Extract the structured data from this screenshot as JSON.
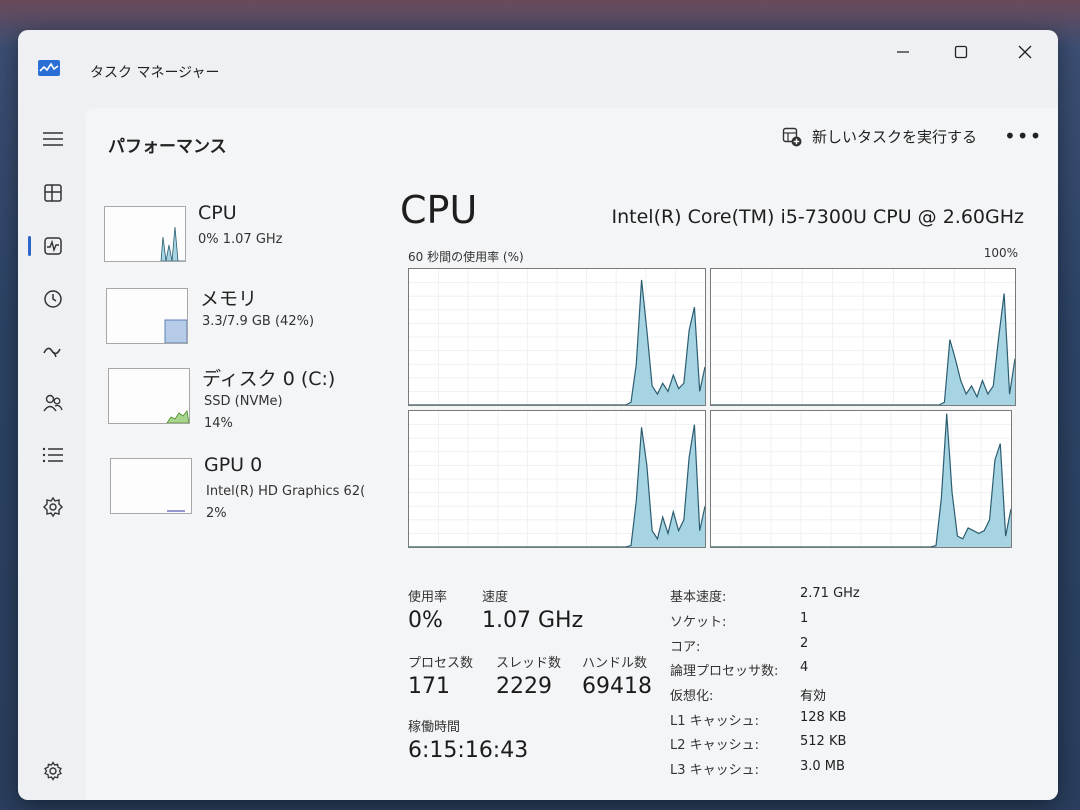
{
  "window": {
    "title": "タスク マネージャー"
  },
  "page": {
    "title": "パフォーマンス",
    "run_task_label": "新しいタスクを実行する",
    "more_label": "•••"
  },
  "nav": [
    "menu-icon",
    "processes-icon",
    "performance-icon",
    "app-history-icon",
    "startup-apps-icon",
    "users-icon",
    "details-icon",
    "services-icon",
    "settings-icon"
  ],
  "sidebar": {
    "items": [
      {
        "title": "CPU",
        "sub": "0%  1.07 GHz",
        "sub2": ""
      },
      {
        "title": "メモリ",
        "sub": "3.3/7.9 GB (42%)",
        "sub2": ""
      },
      {
        "title": "ディスク 0 (C:)",
        "sub": "SSD (NVMe)",
        "sub2": "14%"
      },
      {
        "title": "GPU 0",
        "sub": "Intel(R) HD Graphics 62(",
        "sub2": "2%"
      }
    ]
  },
  "main": {
    "title": "CPU",
    "processor": "Intel(R) Core(TM) i5-7300U CPU @ 2.60GHz",
    "graph_label": "60 秒間の使用率 (%)",
    "graph_max": "100%",
    "graph_color": "#a6d4e2",
    "graph_line": "#2c5d70",
    "cores": [
      [
        0,
        0,
        0,
        0,
        0,
        0,
        0,
        0,
        0,
        0,
        0,
        0,
        0,
        0,
        0,
        0,
        0,
        0,
        0,
        0,
        0,
        0,
        0,
        0,
        0,
        0,
        0,
        0,
        0,
        0,
        0,
        0,
        0,
        0,
        0,
        0,
        0,
        0,
        0,
        0,
        0,
        0,
        2,
        30,
        92,
        55,
        14,
        8,
        16,
        10,
        22,
        12,
        16,
        55,
        72,
        10,
        28
      ],
      [
        0,
        0,
        0,
        0,
        0,
        0,
        0,
        0,
        0,
        0,
        0,
        0,
        0,
        0,
        0,
        0,
        0,
        0,
        0,
        0,
        0,
        0,
        0,
        0,
        0,
        0,
        0,
        0,
        0,
        0,
        0,
        0,
        0,
        0,
        0,
        0,
        0,
        0,
        0,
        0,
        0,
        0,
        0,
        2,
        48,
        34,
        18,
        8,
        14,
        6,
        18,
        8,
        14,
        50,
        82,
        8,
        34
      ],
      [
        0,
        0,
        0,
        0,
        0,
        0,
        0,
        0,
        0,
        0,
        0,
        0,
        0,
        0,
        0,
        0,
        0,
        0,
        0,
        0,
        0,
        0,
        0,
        0,
        0,
        0,
        0,
        0,
        0,
        0,
        0,
        0,
        0,
        0,
        0,
        0,
        0,
        0,
        0,
        0,
        0,
        0,
        1,
        34,
        88,
        60,
        12,
        6,
        22,
        10,
        26,
        12,
        20,
        66,
        90,
        12,
        30
      ],
      [
        0,
        0,
        0,
        0,
        0,
        0,
        0,
        0,
        0,
        0,
        0,
        0,
        0,
        0,
        0,
        0,
        0,
        0,
        0,
        0,
        0,
        0,
        0,
        0,
        0,
        0,
        0,
        0,
        0,
        0,
        0,
        0,
        0,
        0,
        0,
        0,
        0,
        0,
        0,
        0,
        0,
        0,
        1,
        36,
        98,
        40,
        8,
        6,
        14,
        12,
        10,
        12,
        20,
        64,
        76,
        8,
        28
      ]
    ],
    "stats": {
      "usage_label": "使用率",
      "usage_value": "0%",
      "speed_label": "速度",
      "speed_value": "1.07 GHz",
      "processes_label": "プロセス数",
      "processes_value": "171",
      "threads_label": "スレッド数",
      "threads_value": "2229",
      "handles_label": "ハンドル数",
      "handles_value": "69418",
      "uptime_label": "稼働時間",
      "uptime_value": "6:15:16:43"
    },
    "specs": [
      {
        "label": "基本速度:",
        "value": "2.71 GHz"
      },
      {
        "label": "ソケット:",
        "value": "1"
      },
      {
        "label": "コア:",
        "value": "2"
      },
      {
        "label": "論理プロセッサ数:",
        "value": "4"
      },
      {
        "label": "仮想化:",
        "value": "有効"
      },
      {
        "label": "L1 キャッシュ:",
        "value": "128 KB"
      },
      {
        "label": "L2 キャッシュ:",
        "value": "512 KB"
      },
      {
        "label": "L3 キャッシュ:",
        "value": "3.0 MB"
      }
    ],
    "memory_usage_percent": 42,
    "disk_usage_percent": 14,
    "gpu_usage_percent": 2
  }
}
